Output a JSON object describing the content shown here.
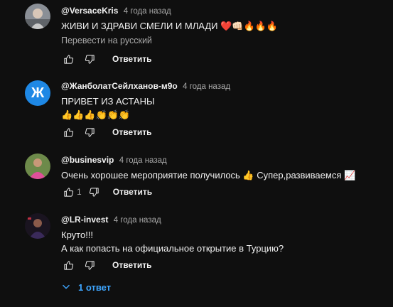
{
  "comments": [
    {
      "author": "@VersaceKris",
      "time": "4 года назад",
      "text_lines": [
        "ЖИВИ И ЗДРАВИ СМЕЛИ И МЛАДИ ❤️👊🏻🔥🔥🔥"
      ],
      "translate_label": "Перевести на русский",
      "likes": "",
      "reply_label": "Ответить"
    },
    {
      "author": "@ЖанболатСейлханов-м9о",
      "time": "4 года назад",
      "avatar_letter": "Ж",
      "text_lines": [
        "ПРИВЕТ ИЗ АСТАНЫ",
        "👍👍👍👏👏👏"
      ],
      "likes": "",
      "reply_label": "Ответить"
    },
    {
      "author": "@businesvip",
      "time": "4 года назад",
      "text_lines": [
        "Очень хорошее мероприятие получилось 👍 Супер,развиваемся 📈"
      ],
      "likes": "1",
      "reply_label": "Ответить"
    },
    {
      "author": "@LR-invest",
      "time": "4 года назад",
      "text_lines": [
        "Круто!!!",
        "А как попасть на официальное открытие в Турцию?"
      ],
      "likes": "",
      "reply_label": "Ответить"
    }
  ],
  "replies_toggle": {
    "label": "1 ответ"
  },
  "colors": {
    "background": "#0f0f0f",
    "link": "#3ea6ff",
    "avatar_blue": "#1e88e5",
    "muted": "#aaaaaa"
  }
}
